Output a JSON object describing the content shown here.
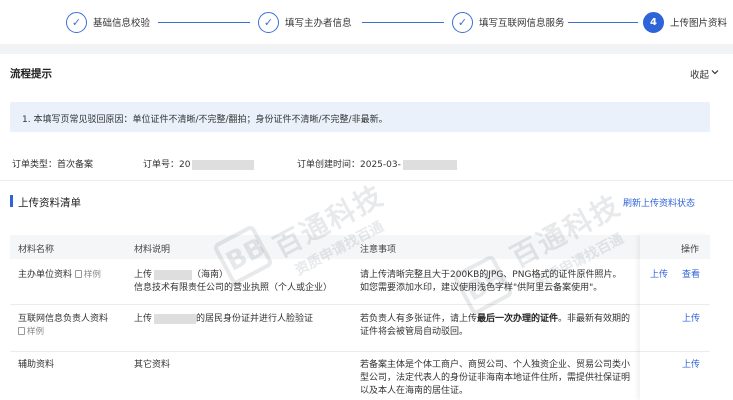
{
  "steps": [
    {
      "label": "基础信息校验",
      "state": "done"
    },
    {
      "label": "填写主办者信息",
      "state": "done"
    },
    {
      "label": "填写互联网信息服务",
      "state": "done"
    },
    {
      "label": "上传图片资料",
      "state": "active",
      "number": "4"
    }
  ],
  "flow": {
    "title": "流程提示",
    "collapse_label": "收起",
    "tip": "1. 本填写页常见驳回原因：单位证件不清晰/不完整/翻拍；身份证件不清晰/不完整/非最新。"
  },
  "order": {
    "type_label": "订单类型：首次备案",
    "number_label": "订单号：20",
    "created_label": "订单创建时间：2025-03-"
  },
  "section": {
    "title": "上传资料清单",
    "refresh_link": "刷新上传资料状态"
  },
  "table": {
    "headers": [
      "材料名称",
      "材料说明",
      "注意事项",
      "操作"
    ],
    "rows": [
      {
        "name": "主办单位资料",
        "sample": "样例",
        "desc_line1_prefix": "上传",
        "desc_line1_suffix": "（海南）",
        "desc_line2": "信息技术有限责任公司的营业执照（个人或企业）",
        "note_line1": "请上传清晰完整且大于200KB的JPG、PNG格式的证件原件照片。",
        "note_line2": "如您需要添加水印，建议使用浅色字样\"供阿里云备案使用\"。",
        "actions": [
          "上传",
          "查看"
        ]
      },
      {
        "name": "互联网信息负责人资料",
        "sample": "样例",
        "desc_line1_prefix": "上传",
        "desc_line1_suffix": "的居民身份证并进行人脸验证",
        "note_line1_prefix": "若负责人有多张证件，请上传",
        "note_line1_bold": "最后一次办理的证件",
        "note_line1_suffix": "。非最新有效期的",
        "note_line2": "证件将会被管局自动驳回。",
        "actions": [
          "上传"
        ]
      },
      {
        "name": "辅助资料",
        "desc_line1": "其它资料",
        "note_line1": "若备案主体是个体工商户、商贸公司、个人独资企业、贸易公司类小",
        "note_line2": "型公司，法定代表人的身份证非海南本地证件住所，需提供社保证明",
        "note_line3": "以及本人在海南的居住证。",
        "actions": [
          "上传"
        ]
      }
    ]
  },
  "watermark": {
    "brand": "百通科技",
    "slogan": "资质申请找百通",
    "logo": "BB"
  }
}
